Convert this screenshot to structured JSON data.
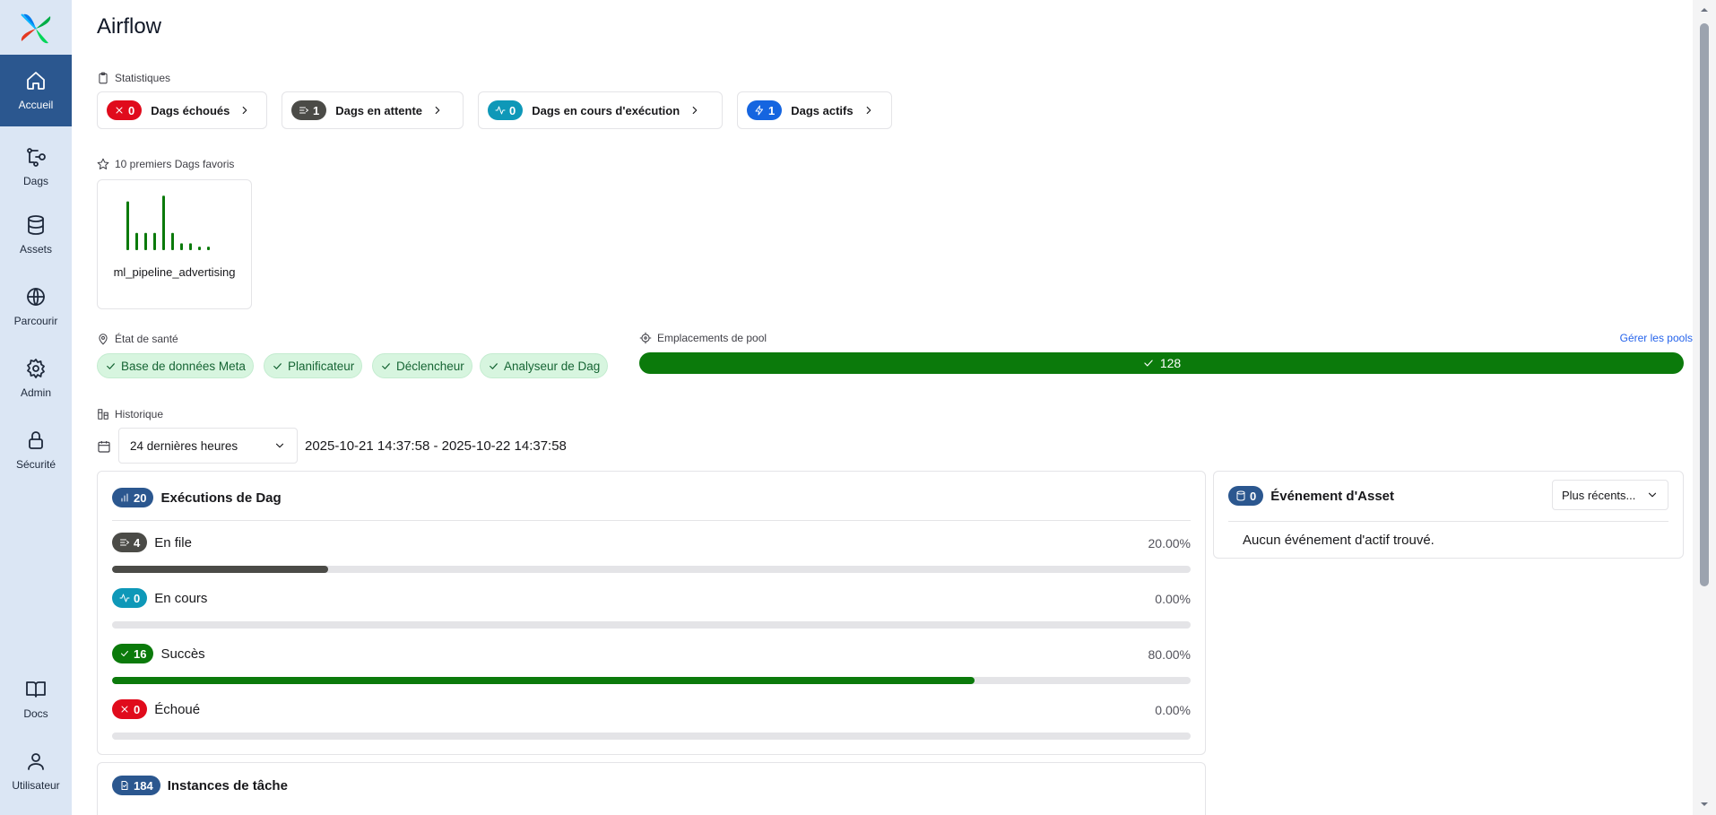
{
  "app": {
    "title": "Airflow"
  },
  "sidebar": {
    "items": [
      {
        "label": "Accueil",
        "icon": "home-icon",
        "active": true
      },
      {
        "label": "Dags",
        "icon": "dags-icon"
      },
      {
        "label": "Assets",
        "icon": "database-icon"
      },
      {
        "label": "Parcourir",
        "icon": "globe-icon"
      },
      {
        "label": "Admin",
        "icon": "gear-icon"
      },
      {
        "label": "Sécurité",
        "icon": "lock-icon"
      },
      {
        "label": "Docs",
        "icon": "book-icon"
      },
      {
        "label": "Utilisateur",
        "icon": "user-icon"
      }
    ]
  },
  "stats": {
    "label": "Statistiques",
    "cards": [
      {
        "count": "0",
        "label": "Dags échoués",
        "color": "#e00b1c",
        "icon": "x-icon"
      },
      {
        "count": "1",
        "label": "Dags en attente",
        "color": "#4b4b47",
        "icon": "queue-icon"
      },
      {
        "count": "0",
        "label": "Dags en cours d'exécution",
        "color": "#0e98b8",
        "icon": "activity-icon"
      },
      {
        "count": "1",
        "label": "Dags actifs",
        "color": "#1565e0",
        "icon": "bolt-icon"
      }
    ]
  },
  "favorites": {
    "label": "10 premiers Dags favoris",
    "dags": [
      {
        "name": "ml_pipeline_advertising",
        "recent_runs": [
          0.85,
          0.3,
          0.3,
          0.3,
          0.95,
          0.3,
          0.12,
          0.12,
          0.06,
          0.06
        ]
      }
    ]
  },
  "health": {
    "label": "État de santé",
    "items": [
      "Base de données Meta",
      "Planificateur",
      "Déclencheur",
      "Analyseur de Dag"
    ]
  },
  "pool": {
    "label": "Emplacements de pool",
    "manage_link": "Gérer les pools",
    "value": "128",
    "color": "#0b7a0b"
  },
  "history": {
    "label": "Historique",
    "range_select": "24 dernières heures",
    "range_text": "2025-10-21 14:37:58 - 2025-10-22 14:37:58"
  },
  "dag_runs": {
    "title": "Exécutions de Dag",
    "total": "20",
    "rows": [
      {
        "count": "4",
        "label": "En file",
        "pct": "20.00%",
        "fraction": 0.2,
        "color": "#4b4b47",
        "icon": "queue-icon"
      },
      {
        "count": "0",
        "label": "En cours",
        "pct": "0.00%",
        "fraction": 0.0,
        "color": "#0e98b8",
        "icon": "activity-icon"
      },
      {
        "count": "16",
        "label": "Succès",
        "pct": "80.00%",
        "fraction": 0.8,
        "color": "#0b7a0b",
        "icon": "check-icon"
      },
      {
        "count": "0",
        "label": "Échoué",
        "pct": "0.00%",
        "fraction": 0.0,
        "color": "#e00b1c",
        "icon": "x-icon"
      }
    ]
  },
  "asset_events": {
    "title": "Événement d'Asset",
    "count": "0",
    "sort_select": "Plus récents...",
    "empty_text": "Aucun événement d'actif trouvé."
  },
  "task_instances": {
    "title": "Instances de tâche",
    "total": "184"
  }
}
